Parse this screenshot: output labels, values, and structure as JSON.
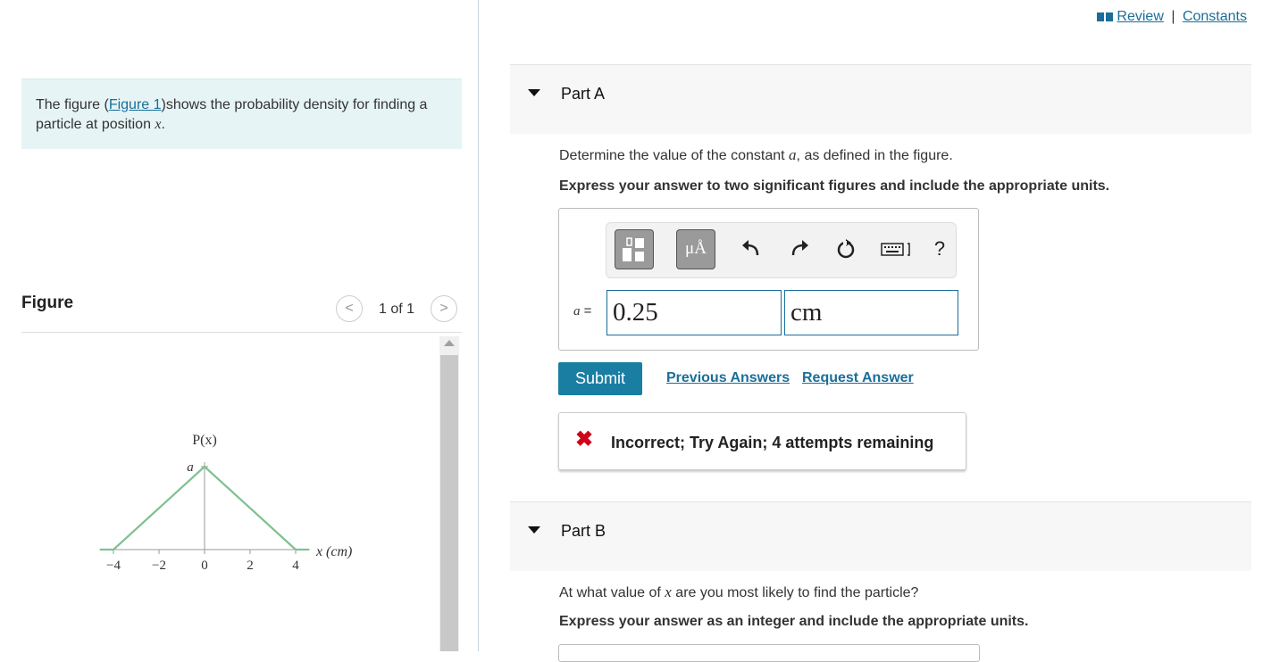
{
  "header": {
    "review": "Review",
    "separator": "|",
    "constants": "Constants"
  },
  "intro": {
    "text_before": "The figure (",
    "figure_link": "Figure 1",
    "text_after": ")shows the probability density for finding a particle at position ",
    "var": "x",
    "period": "."
  },
  "figure": {
    "title": "Figure",
    "counter": "1 of 1",
    "prev": "<",
    "next": ">"
  },
  "chart_data": {
    "type": "line",
    "x": [
      -4,
      0,
      4
    ],
    "y_labels": [
      "0",
      "a",
      "0"
    ],
    "ylabel": "P(x)",
    "peak_label": "a",
    "xlabel": "x (cm)",
    "x_ticks": [
      "−4",
      "−2",
      "0",
      "2",
      "4"
    ],
    "line_color": "#7fc190"
  },
  "partA": {
    "title": "Part A",
    "question_before": "Determine the value of the constant ",
    "question_var": "a",
    "question_after": ", as defined in the figure.",
    "instruction": "Express your answer to two significant figures and include the appropriate units.",
    "toolbar": {
      "units_label": "μÅ",
      "help": "?"
    },
    "answer_label_var": "a",
    "answer_label_eq": " =",
    "value": "0.25",
    "units": "cm",
    "submit": "Submit",
    "previous_answers": "Previous Answers",
    "request_answer": "Request Answer",
    "feedback": "Incorrect; Try Again; 4 attempts remaining",
    "feedback_icon": "✖"
  },
  "partB": {
    "title": "Part B",
    "question_before": "At what value of ",
    "question_var": "x",
    "question_after": " are you most likely to find the particle?",
    "instruction": "Express your answer as an integer and include the appropriate units."
  }
}
